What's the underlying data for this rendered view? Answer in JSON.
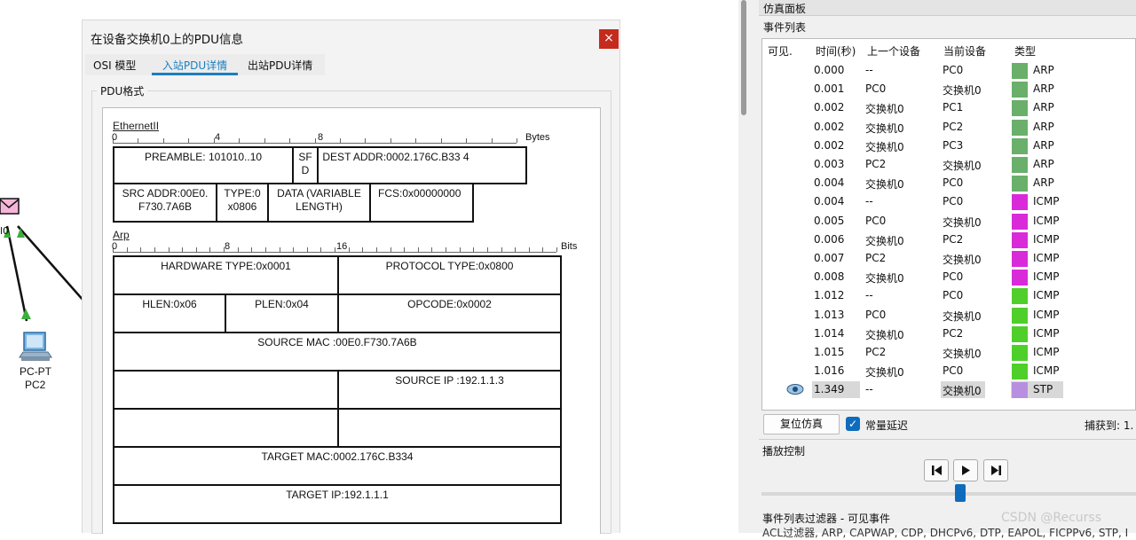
{
  "canvas": {
    "pc2_type": "PC-PT",
    "pc2_name": "PC2",
    "switch_label_fragment": "l0"
  },
  "dialog": {
    "title": "在设备交换机0上的PDU信息",
    "close_glyph": "×",
    "tabs": [
      "OSI 模型",
      "入站PDU详情",
      "出站PDU详情"
    ],
    "active_tab": "入站PDU详情",
    "format_label": "PDU格式"
  },
  "ethernet": {
    "title": "EthernetII",
    "ruler_numbers": [
      "0",
      "4",
      "8"
    ],
    "unit": "Bytes",
    "fields": {
      "preamble": "PREAMBLE: 101010..10",
      "sfd": "SF D",
      "dest_addr": "DEST ADDR:0002.176C.B33 4",
      "src_addr": "SRC ADDR:00E0. F730.7A6B",
      "type": "TYPE:0 x0806",
      "data": "DATA (VARIABLE LENGTH)",
      "fcs": "FCS:0x00000000"
    }
  },
  "arp": {
    "title": "Arp",
    "ruler_numbers": [
      "0",
      "8",
      "16"
    ],
    "unit": "Bits",
    "fields": {
      "hardware_type": "HARDWARE TYPE:0x0001",
      "protocol_type": "PROTOCOL TYPE:0x0800",
      "hlen": "HLEN:0x06",
      "plen": "PLEN:0x04",
      "opcode": "OPCODE:0x0002",
      "source_mac": "SOURCE MAC :00E0.F730.7A6B",
      "source_ip": "SOURCE IP :192.1.1.3",
      "target_mac": "TARGET MAC:0002.176C.B334",
      "target_ip": "TARGET IP:192.1.1.1"
    }
  },
  "sim_panel": {
    "title": "仿真面板",
    "event_list_label": "事件列表",
    "columns": [
      "可见.",
      "时间(秒)",
      "上一个设备",
      "当前设备",
      "类型"
    ],
    "events": [
      {
        "time": "0.000",
        "prev": "--",
        "cur": "PC0",
        "type": "ARP",
        "color": "#6aaf6a"
      },
      {
        "time": "0.001",
        "prev": "PC0",
        "cur": "交换机0",
        "type": "ARP",
        "color": "#6aaf6a"
      },
      {
        "time": "0.002",
        "prev": "交换机0",
        "cur": "PC1",
        "type": "ARP",
        "color": "#6aaf6a"
      },
      {
        "time": "0.002",
        "prev": "交换机0",
        "cur": "PC2",
        "type": "ARP",
        "color": "#6aaf6a"
      },
      {
        "time": "0.002",
        "prev": "交换机0",
        "cur": "PC3",
        "type": "ARP",
        "color": "#6aaf6a"
      },
      {
        "time": "0.003",
        "prev": "PC2",
        "cur": "交换机0",
        "type": "ARP",
        "color": "#6aaf6a"
      },
      {
        "time": "0.004",
        "prev": "交换机0",
        "cur": "PC0",
        "type": "ARP",
        "color": "#6aaf6a"
      },
      {
        "time": "0.004",
        "prev": "--",
        "cur": "PC0",
        "type": "ICMP",
        "color": "#d92ad9"
      },
      {
        "time": "0.005",
        "prev": "PC0",
        "cur": "交换机0",
        "type": "ICMP",
        "color": "#d92ad9"
      },
      {
        "time": "0.006",
        "prev": "交换机0",
        "cur": "PC2",
        "type": "ICMP",
        "color": "#d92ad9"
      },
      {
        "time": "0.007",
        "prev": "PC2",
        "cur": "交换机0",
        "type": "ICMP",
        "color": "#d92ad9"
      },
      {
        "time": "0.008",
        "prev": "交换机0",
        "cur": "PC0",
        "type": "ICMP",
        "color": "#d92ad9"
      },
      {
        "time": "1.012",
        "prev": "--",
        "cur": "PC0",
        "type": "ICMP",
        "color": "#4fcf2a"
      },
      {
        "time": "1.013",
        "prev": "PC0",
        "cur": "交换机0",
        "type": "ICMP",
        "color": "#4fcf2a"
      },
      {
        "time": "1.014",
        "prev": "交换机0",
        "cur": "PC2",
        "type": "ICMP",
        "color": "#4fcf2a"
      },
      {
        "time": "1.015",
        "prev": "PC2",
        "cur": "交换机0",
        "type": "ICMP",
        "color": "#4fcf2a"
      },
      {
        "time": "1.016",
        "prev": "交换机0",
        "cur": "PC0",
        "type": "ICMP",
        "color": "#4fcf2a"
      },
      {
        "time": "1.349",
        "prev": "--",
        "cur": "交换机0",
        "type": "STP",
        "color": "#b88fe0",
        "current": true
      }
    ],
    "reset_label": "复位仿真",
    "constant_delay_label": "常量延迟",
    "constant_delay_checked": true,
    "captured_label": "捕获到: 1.",
    "playback_label": "播放控制",
    "slider_value": 0.53,
    "filter_label": "事件列表过滤器 - 可见事件",
    "filter_text": "ACL过滤器, ARP, CAPWAP, CDP, DHCPv6, DTP, EAPOL, FICPPv6, STP, I",
    "watermark": "CSDN @Recurss"
  }
}
